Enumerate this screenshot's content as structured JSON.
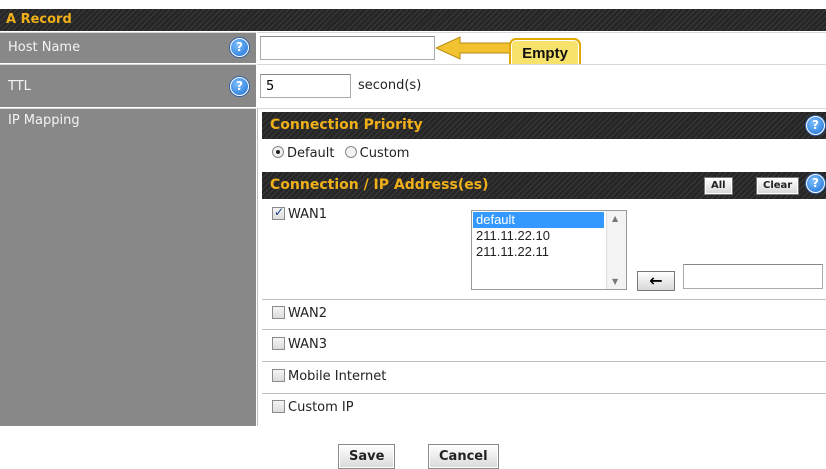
{
  "section": {
    "title": "A Record"
  },
  "host_name": {
    "label": "Host Name",
    "value": "",
    "callout": "Empty"
  },
  "ttl": {
    "label": "TTL",
    "value": "5",
    "unit": "second(s)"
  },
  "ip_mapping": {
    "label": "IP Mapping",
    "connection_priority": {
      "title": "Connection Priority",
      "options": [
        {
          "label": "Default",
          "selected": true
        },
        {
          "label": "Custom",
          "selected": false
        }
      ]
    },
    "connection_ip": {
      "title": "Connection / IP Address(es)",
      "all_label": "All",
      "clear_label": "Clear",
      "rows": [
        {
          "label": "WAN1",
          "checked": true
        },
        {
          "label": "WAN2",
          "checked": false
        },
        {
          "label": "WAN3",
          "checked": false
        },
        {
          "label": "Mobile Internet",
          "checked": false
        },
        {
          "label": "Custom IP",
          "checked": false
        }
      ],
      "ip_list": [
        {
          "label": "default",
          "selected": true
        },
        {
          "label": "211.11.22.10",
          "selected": false
        },
        {
          "label": "211.11.22.11",
          "selected": false
        }
      ],
      "add_arrow": "←",
      "ip_input": ""
    }
  },
  "footer": {
    "save_label": "Save",
    "cancel_label": "Cancel"
  },
  "icons": {
    "help": "help-icon",
    "arrow": "arrow-left-icon"
  },
  "colors": {
    "accent": "#f0b01a",
    "label_bg": "#888888",
    "header_bg": "#2a2a2a",
    "callout_bg": "#f7e26b"
  }
}
